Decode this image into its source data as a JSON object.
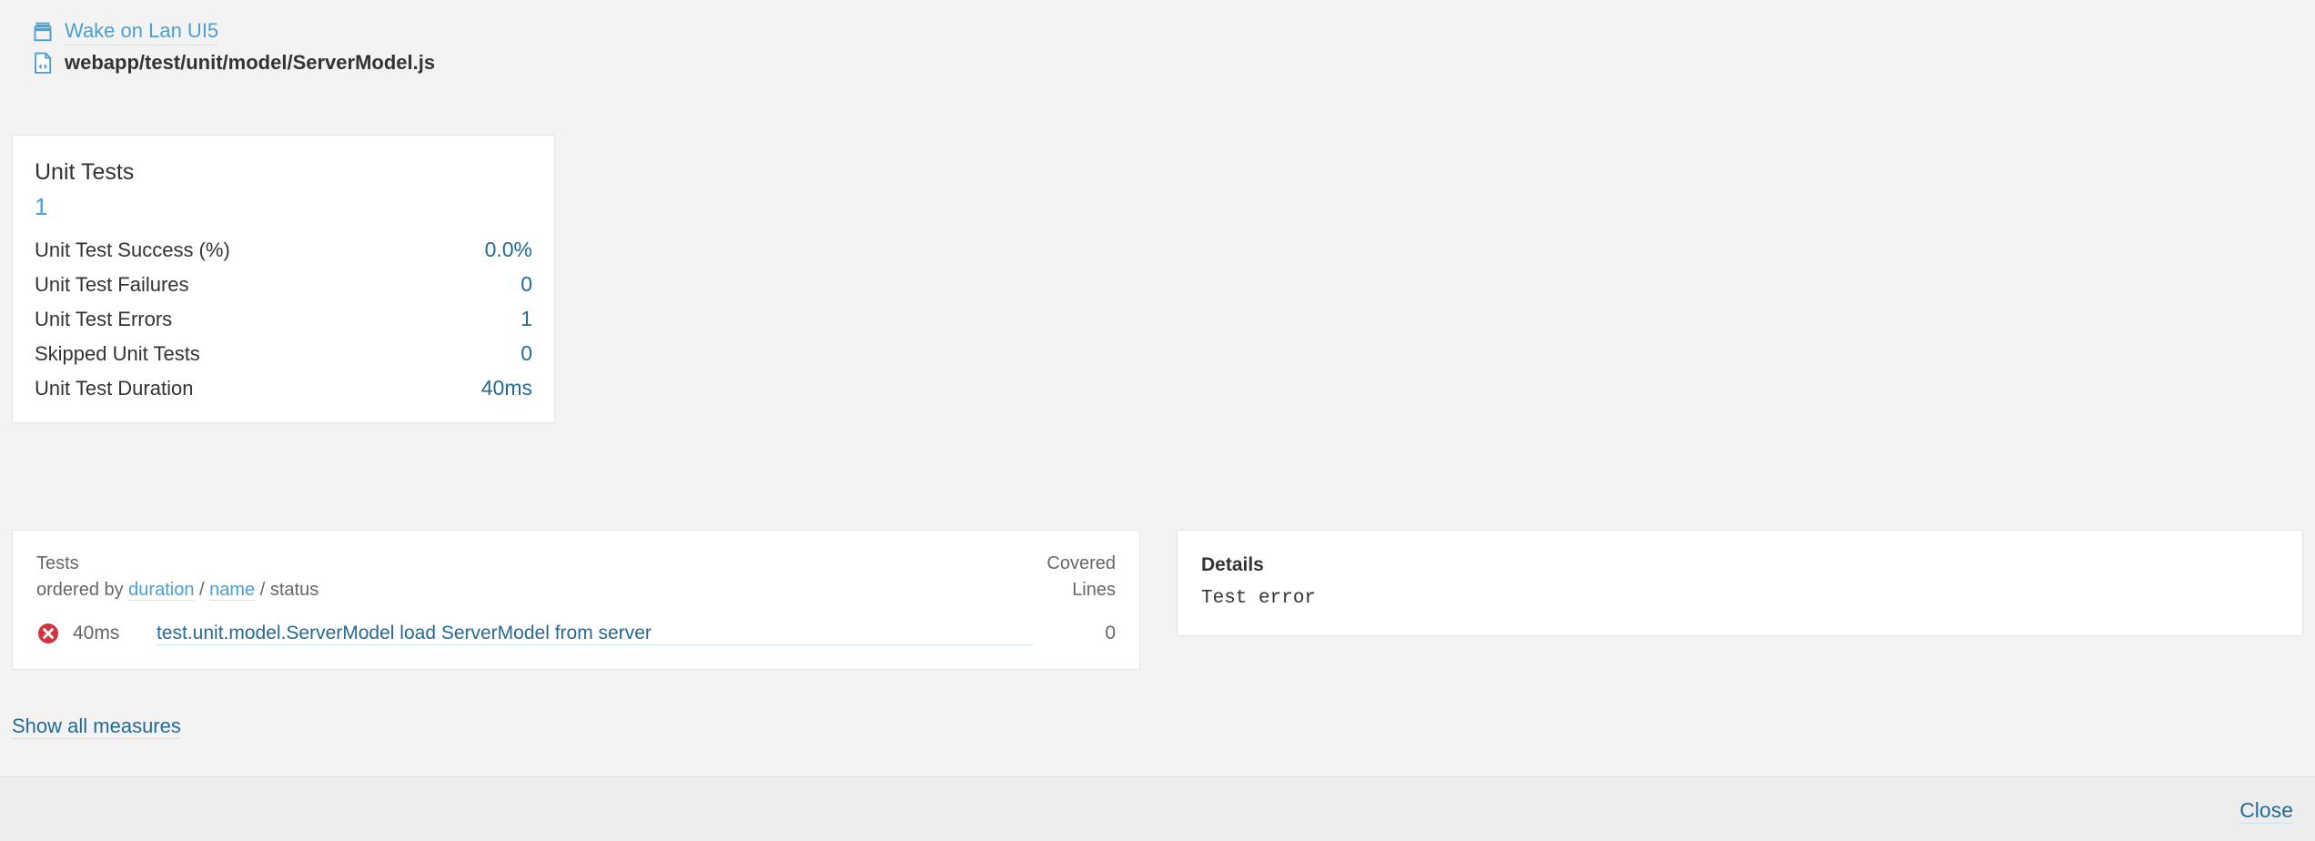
{
  "breadcrumb": {
    "project": {
      "label": "Wake on Lan UI5",
      "icon": "project-box-icon"
    },
    "file": {
      "label": "webapp/test/unit/model/ServerModel.js",
      "icon": "code-file-icon"
    }
  },
  "measures_card": {
    "title": "Unit Tests",
    "big_value": "1",
    "rows": [
      {
        "name": "Unit Test Success (%)",
        "value": "0.0%"
      },
      {
        "name": "Unit Test Failures",
        "value": "0"
      },
      {
        "name": "Unit Test Errors",
        "value": "1"
      },
      {
        "name": "Skipped Unit Tests",
        "value": "0"
      },
      {
        "name": "Unit Test Duration",
        "value": "40ms"
      }
    ]
  },
  "tests_panel": {
    "title": "Tests",
    "order_prefix": "ordered by ",
    "order_options": [
      {
        "label": "duration",
        "active": false
      },
      {
        "label": "name",
        "active": false
      },
      {
        "label": "status",
        "active": true
      }
    ],
    "order_separator": " / ",
    "covered_header_line1": "Covered",
    "covered_header_line2": "Lines",
    "rows": [
      {
        "status": "error",
        "status_icon": "error-circle-icon",
        "duration": "40ms",
        "name": "test.unit.model.ServerModel load ServerModel from server",
        "covered_lines": "0"
      }
    ]
  },
  "details_panel": {
    "title": "Details",
    "body": "Test error"
  },
  "show_all_measures": {
    "label": "Show all measures"
  },
  "footer": {
    "close_label": "Close"
  },
  "colors": {
    "link": "#4b9fd5",
    "link_dark": "#236a97",
    "text": "#333333",
    "muted": "#666666",
    "background": "#f3f3f3",
    "panel": "#ffffff",
    "border": "#e6e6e6",
    "error": "#d4333f",
    "footer_bg": "#ededed"
  }
}
